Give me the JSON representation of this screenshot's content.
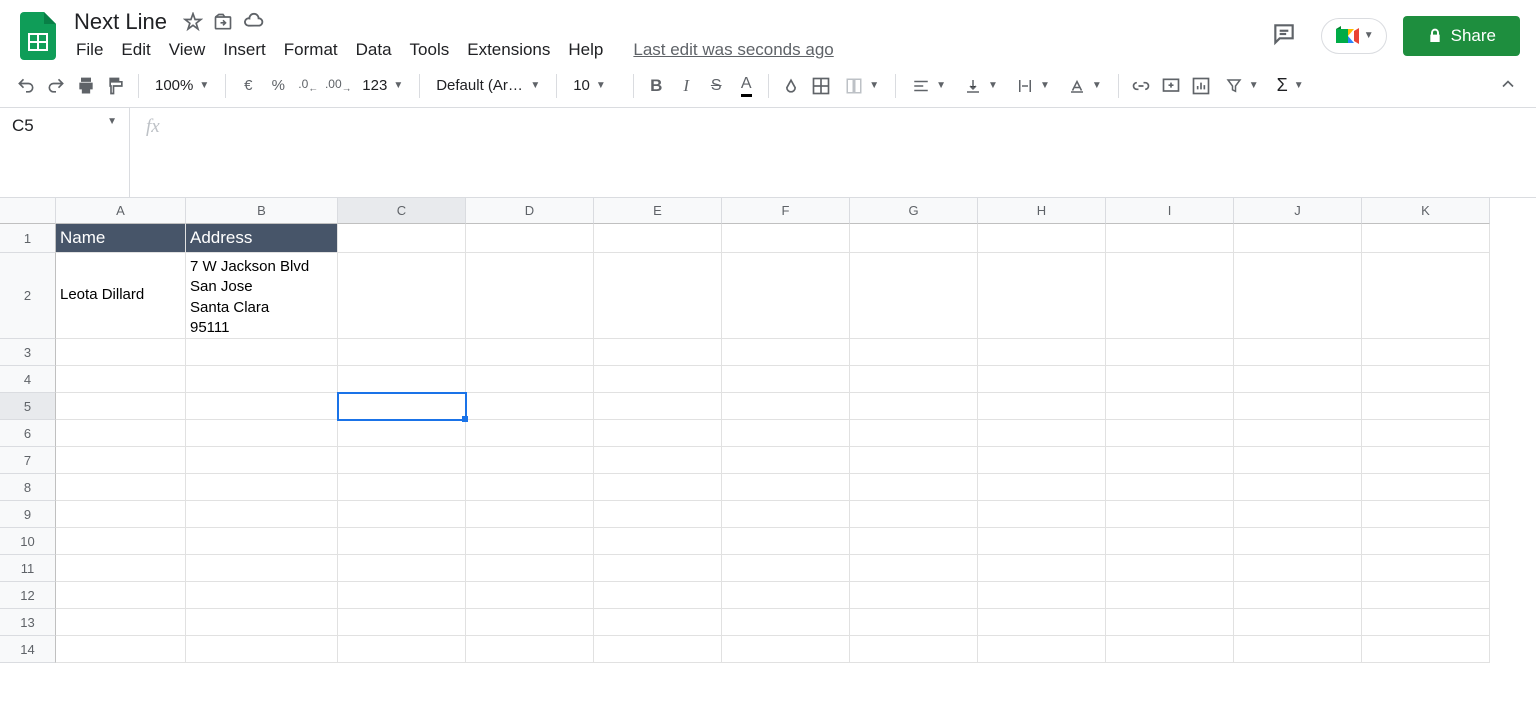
{
  "doc": {
    "title": "Next Line",
    "last_edit": "Last edit was seconds ago"
  },
  "menu": {
    "file": "File",
    "edit": "Edit",
    "view": "View",
    "insert": "Insert",
    "format": "Format",
    "data": "Data",
    "tools": "Tools",
    "extensions": "Extensions",
    "help": "Help"
  },
  "share": {
    "label": "Share"
  },
  "toolbar": {
    "zoom": "100%",
    "currency": "€",
    "percent": "%",
    "dec_dec": ".0",
    "dec_inc": ".00",
    "fmt_more": "123",
    "font": "Default (Ari…",
    "size": "10"
  },
  "namebox": {
    "cell": "C5"
  },
  "fx": {
    "label": "fx"
  },
  "columns": [
    "A",
    "B",
    "C",
    "D",
    "E",
    "F",
    "G",
    "H",
    "I",
    "J",
    "K"
  ],
  "rows": [
    1,
    2,
    3,
    4,
    5,
    6,
    7,
    8,
    9,
    10,
    11,
    12,
    13,
    14
  ],
  "selected_col": "C",
  "selected_row": 5,
  "cells": {
    "headers": {
      "A1": "Name",
      "B1": "Address"
    },
    "A2": "Leota Dillard",
    "B2": "7 W Jackson Blvd\nSan Jose\nSanta Clara\n95111"
  }
}
